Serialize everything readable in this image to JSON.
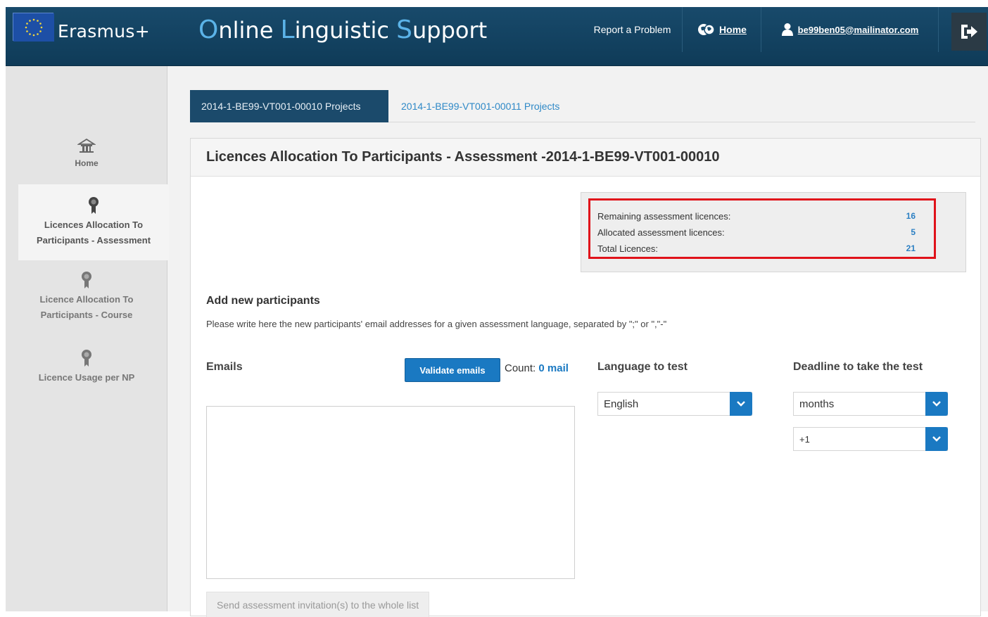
{
  "header": {
    "brand": "Erasmus+",
    "title_parts": [
      {
        "cap": "O",
        "rest": "nline "
      },
      {
        "cap": "L",
        "rest": "inguistic "
      },
      {
        "cap": "S",
        "rest": "upport"
      }
    ],
    "report_label": "Report a Problem",
    "home_label": "Home",
    "user_email": "be99ben05@mailinator.com"
  },
  "sidebar": {
    "items": [
      {
        "label": "Home"
      },
      {
        "label_lines": [
          "Licences Allocation To",
          "Participants - Assessment"
        ]
      },
      {
        "label_lines": [
          "Licence Allocation To",
          "Participants - Course"
        ]
      },
      {
        "label": "Licence Usage per NP"
      }
    ]
  },
  "tabs": [
    {
      "label": "2014-1-BE99-VT001-00010 Projects"
    },
    {
      "label": "2014-1-BE99-VT001-00011 Projects"
    }
  ],
  "panel": {
    "title": "Licences Allocation To Participants - Assessment -2014-1-BE99-VT001-00010",
    "stats": [
      {
        "label": "Remaining assessment licences:",
        "value": "16"
      },
      {
        "label": "Allocated assessment licences:",
        "value": "5"
      },
      {
        "label": "Total Licences:",
        "value": "21"
      }
    ],
    "section_title": "Add new participants",
    "section_desc": "Please write here the new participants' email addresses for a given assessment language, separated by \";\" or \",\"-\"",
    "emails_label": "Emails",
    "validate_label": "Validate emails",
    "count_prefix": "Count:",
    "count_value": "0 mail",
    "language_label": "Language to test",
    "language_value": "English",
    "deadline_label": "Deadline to take the test",
    "deadline_unit": "months",
    "deadline_amount": "+1",
    "send_label": "Send assessment invitation(s) to the whole list"
  },
  "colors": {
    "header_bg": "#184a6b",
    "accent": "#1a79c2",
    "highlight_border": "#e0121a"
  }
}
